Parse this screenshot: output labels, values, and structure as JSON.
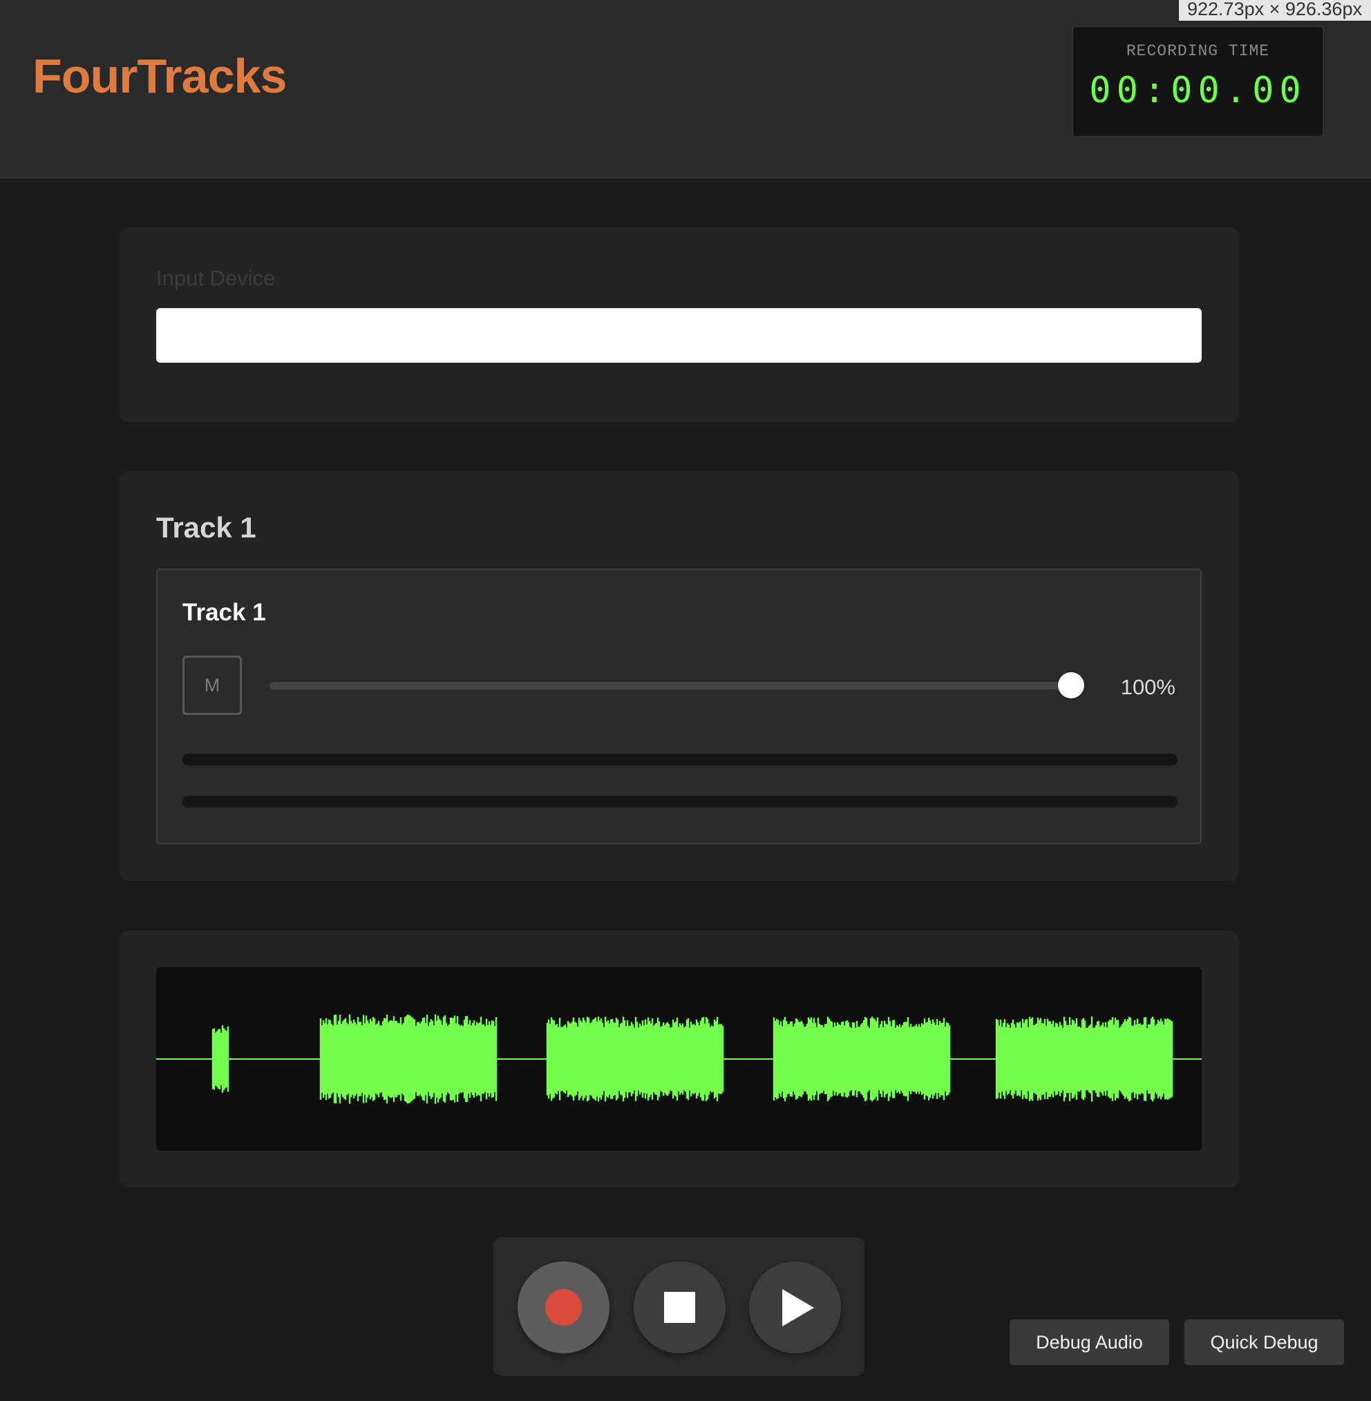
{
  "app": {
    "logo": "FourTracks",
    "brand_color": "#e07b3f",
    "dims_badge": "922.73px × 926.36px"
  },
  "timer": {
    "label": "RECORDING TIME",
    "value": "00:00.00",
    "color": "#6dff4a"
  },
  "input": {
    "label": "Input Device",
    "selected": ""
  },
  "track_section": {
    "heading": "Track 1"
  },
  "track": {
    "name": "Track 1",
    "mute_label": "M",
    "volume_label": "100%",
    "volume": 1.0,
    "meter_levels": [
      0,
      0
    ]
  },
  "waveform": {
    "color": "#73ff4b",
    "background": "#0f0f0f"
  },
  "transport": {
    "record_icon": "record-icon",
    "stop_icon": "stop-icon",
    "play_icon": "play-icon"
  },
  "debug": {
    "audio_label": "Debug Audio",
    "quick_label": "Quick Debug"
  }
}
